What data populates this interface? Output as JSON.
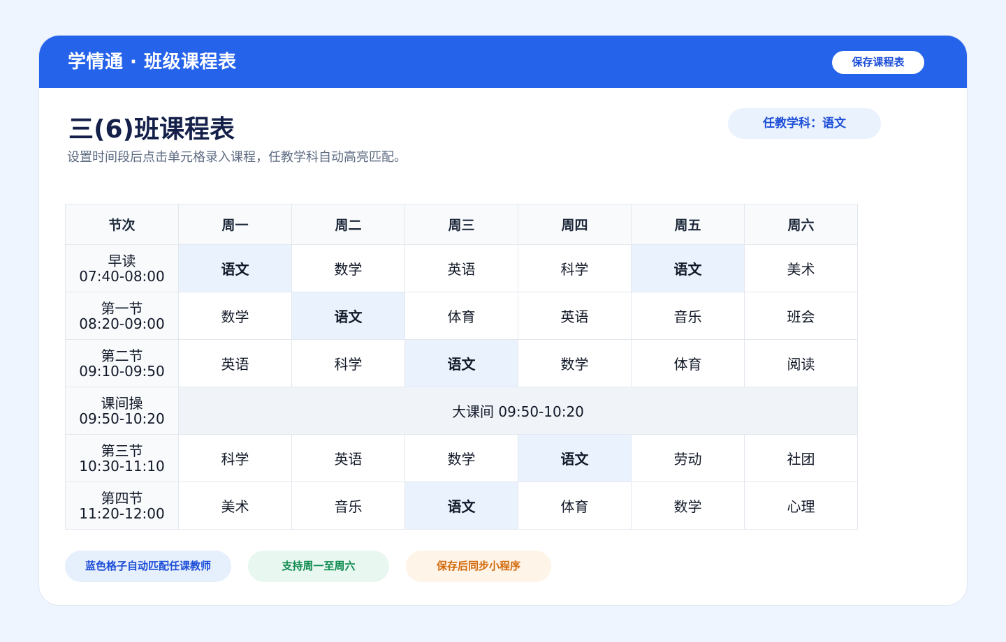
{
  "header": {
    "app_title": "学情通 · 班级课程表",
    "save_label": "保存课程表"
  },
  "page": {
    "title": "三(6)班课程表",
    "subtitle": "设置时间段后点击单元格录入课程，任教学科自动高亮匹配。",
    "subject_pill": "任教学科：语文"
  },
  "timetable": {
    "highlight_subject": "语文",
    "columns": [
      "节次",
      "周一",
      "周二",
      "周三",
      "周四",
      "周五",
      "周六"
    ],
    "rows": [
      {
        "name": "早读",
        "time": "07:40-08:00",
        "cells": [
          "语文",
          "数学",
          "英语",
          "科学",
          "语文",
          "美术"
        ]
      },
      {
        "name": "第一节",
        "time": "08:20-09:00",
        "cells": [
          "数学",
          "语文",
          "体育",
          "英语",
          "音乐",
          "班会"
        ]
      },
      {
        "name": "第二节",
        "time": "09:10-09:50",
        "cells": [
          "英语",
          "科学",
          "语文",
          "数学",
          "体育",
          "阅读"
        ]
      },
      {
        "name": "课间操",
        "time": "09:50-10:20",
        "break_label": "大课间 09:50-10:20"
      },
      {
        "name": "第三节",
        "time": "10:30-11:10",
        "cells": [
          "科学",
          "英语",
          "数学",
          "语文",
          "劳动",
          "社团"
        ]
      },
      {
        "name": "第四节",
        "time": "11:20-12:00",
        "cells": [
          "美术",
          "音乐",
          "语文",
          "体育",
          "数学",
          "心理"
        ]
      }
    ]
  },
  "tags": [
    {
      "label": "蓝色格子自动匹配任课教师",
      "color": "#1d4ed8"
    },
    {
      "label": "支持周一至周六",
      "color": "#0f8a4f"
    },
    {
      "label": "保存后同步小程序",
      "color": "#d26a0c"
    }
  ],
  "colors": {
    "accent": "#2563eb",
    "match_bg": "#eaf2fe",
    "page_bg": "#eff5fe"
  }
}
